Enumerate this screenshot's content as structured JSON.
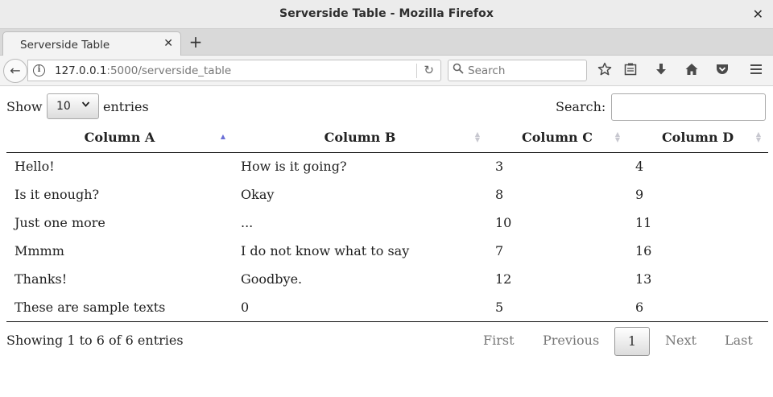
{
  "window": {
    "title": "Serverside Table - Mozilla Firefox",
    "close_glyph": "✕"
  },
  "tabs": [
    {
      "label": "Serverside Table",
      "close_glyph": "✕"
    }
  ],
  "new_tab_glyph": "+",
  "nav": {
    "back_glyph": "←",
    "url_host": "127.0.0.1",
    "url_rest": ":5000/serverside_table",
    "reload_glyph": "↻",
    "search_placeholder": "Search",
    "icons": [
      "star-icon",
      "reading-list-icon",
      "download-icon",
      "home-icon",
      "pocket-icon",
      "menu-icon"
    ]
  },
  "table_controls": {
    "show_label": "Show",
    "entries_value": "10",
    "entries_label": "entries",
    "search_label": "Search:",
    "search_value": ""
  },
  "table": {
    "columns": [
      "Column A",
      "Column B",
      "Column C",
      "Column D"
    ],
    "rows": [
      [
        "Hello!",
        "How is it going?",
        "3",
        "4"
      ],
      [
        "Is it enough?",
        "Okay",
        "8",
        "9"
      ],
      [
        "Just one more",
        "...",
        "10",
        "11"
      ],
      [
        "Mmmm",
        "I do not know what to say",
        "7",
        "16"
      ],
      [
        "Thanks!",
        "Goodbye.",
        "12",
        "13"
      ],
      [
        "These are sample texts",
        "0",
        "5",
        "6"
      ]
    ]
  },
  "footer": {
    "info": "Showing 1 to 6 of 6 entries",
    "pagination": {
      "first": "First",
      "previous": "Previous",
      "current": "1",
      "next": "Next",
      "last": "Last"
    }
  },
  "colors": {
    "sort_active": "#6b6fd6",
    "sort_inactive": "#c8c8d0"
  }
}
